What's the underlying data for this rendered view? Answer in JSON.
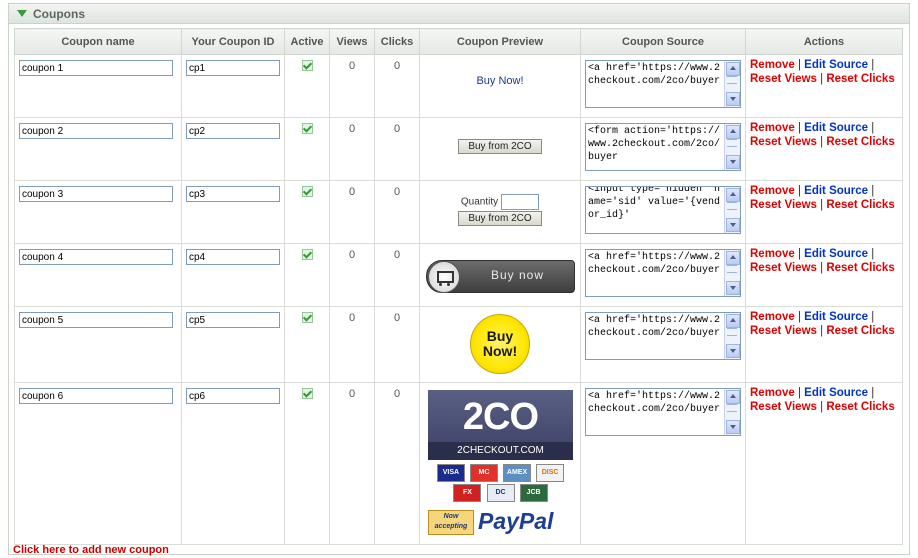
{
  "panel": {
    "title": "Coupons"
  },
  "columns": [
    "Coupon name",
    "Your Coupon ID",
    "Active",
    "Views",
    "Clicks",
    "Coupon Preview",
    "Coupon Source",
    "Actions"
  ],
  "actions": {
    "remove": "Remove",
    "edit": "Edit Source",
    "reset_views": "Reset Views",
    "reset_clicks": "Reset Clicks",
    "sep": "|"
  },
  "rows": [
    {
      "name": "coupon 1",
      "cid": "cp1",
      "views": "0",
      "clicks": "0",
      "preview": {
        "link_text": "Buy Now!"
      },
      "source": "<a href='https://www.2checkout.com/2co/buyer"
    },
    {
      "name": "coupon 2",
      "cid": "cp2",
      "views": "0",
      "clicks": "0",
      "preview": {
        "button": "Buy from 2CO"
      },
      "source": "<form action='https://www.2checkout.com/2co/buyer"
    },
    {
      "name": "coupon 3",
      "cid": "cp3",
      "views": "0",
      "clicks": "0",
      "preview": {
        "quantity_label": "Quantity",
        "button": "Buy from 2CO"
      },
      "source": "<input type='hidden' name='sid' value='{vendor_id}'"
    },
    {
      "name": "coupon 4",
      "cid": "cp4",
      "views": "0",
      "clicks": "0",
      "preview": {
        "image_label": "Buy now"
      },
      "source": "<a href='https://www.2checkout.com/2co/buyer"
    },
    {
      "name": "coupon 5",
      "cid": "cp5",
      "views": "0",
      "clicks": "0",
      "preview": {
        "line1": "Buy",
        "line2": "Now!"
      },
      "source": "<a href='https://www.2checkout.com/2co/buyer"
    },
    {
      "name": "coupon 6",
      "cid": "cp6",
      "views": "0",
      "clicks": "0",
      "preview": {
        "logo_big": "2CO",
        "logo_small": "2CHECKOUT.COM",
        "cards": [
          "VISA",
          "MC",
          "AMEX",
          "DISC",
          "FX",
          "DC",
          "JCB"
        ],
        "now_accepting": "Now accepting",
        "paypal": "PayPal"
      },
      "source": "<a href='https://www.2checkout.com/2co/buyer"
    }
  ],
  "footer": {
    "add_link": "Click here to add new coupon"
  }
}
